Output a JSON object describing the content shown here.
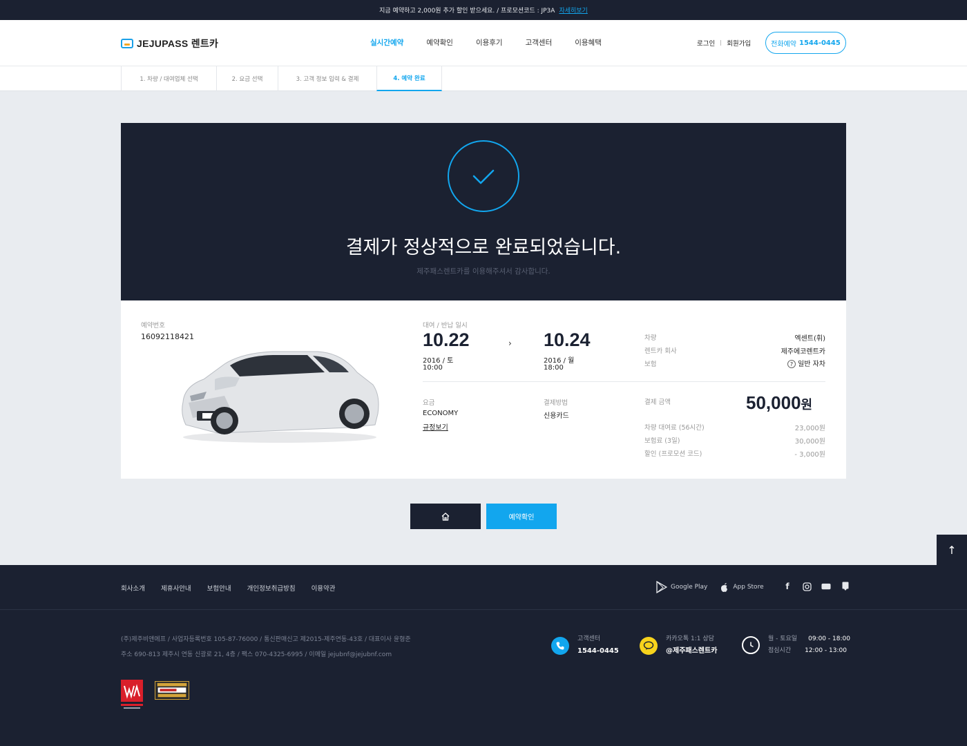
{
  "topbar": {
    "notice": "지금 예약하고 2,000원 추가 할인 받으세요. / 프로모션코드 : JP3A",
    "more": "자세히보기"
  },
  "header": {
    "logo": "JEJUPASS 렌트카",
    "nav": [
      "실시간예약",
      "예약확인",
      "이용후기",
      "고객센터",
      "이용혜택"
    ],
    "login": "로그인",
    "join": "회원가입",
    "call_label": "전화예약",
    "call_number": "1544-0445"
  },
  "steps": [
    "1. 차량 / 대여업체 선택",
    "2. 요금 선택",
    "3. 고객 정보 입력 & 결제",
    "4. 예약 완료"
  ],
  "done": {
    "title": "결제가 정상적으로 완료되었습니다.",
    "subtitle": "제주패스렌트카를 이용해주셔서 감사합니다."
  },
  "reservation": {
    "no_label": "예약번호",
    "no": "16092118421",
    "period_label": "대여 / 반납 일시",
    "start_date": "10.22",
    "start_day": "2016 / 토",
    "start_time": "10:00",
    "end_date": "10.24",
    "end_day": "2016 / 월",
    "end_time": "18:00",
    "fare_label": "요금",
    "fare": "ECONOMY",
    "rule_link": "규정보기",
    "pay_method_label": "결제방법",
    "pay_method": "신용카드",
    "car_label": "차량",
    "car": "엑센트(휘)",
    "company_label": "렌트카 회사",
    "company": "제주에코렌트카",
    "insurance_label": "보험",
    "insurance": "일반 자차",
    "total_label": "결제 금액",
    "total": "50,000",
    "total_unit": "원",
    "items": [
      {
        "label": "차량 대여료 (56시간)",
        "value": "23,000원"
      },
      {
        "label": "보험료 (3일)",
        "value": "30,000원"
      },
      {
        "label": "할인 (프로모션 코드)",
        "value": "- 3,000원"
      }
    ]
  },
  "buttons": {
    "confirm": "예약확인"
  },
  "footer": {
    "nav": [
      "회사소개",
      "제휴사안내",
      "보험안내",
      "개인정보취급방침",
      "이용약관"
    ],
    "google_play": "Google Play",
    "app_store": "App Store",
    "info1": "(주)제주비앤에프   /   사업자등록번호 105-87-76000   /   통신판매신고 제2015-제주연동-43호   /   대표이사 윤형준",
    "info2": "주소 690-813 제주시 연동 신광로 21, 4층   /   팩스 070-4325-6995   /   이메일 jejubnf@jejubnf.com",
    "cs_label": "고객센터",
    "cs_number": "1544-0445",
    "kakao_label": "카카오톡 1:1 상담",
    "kakao_id": "@제주패스렌트카",
    "hours_label1": "월 - 토요일",
    "hours1": "09:00 - 18:00",
    "hours_label2": "점심시간",
    "hours2": "12:00 - 13:00"
  }
}
